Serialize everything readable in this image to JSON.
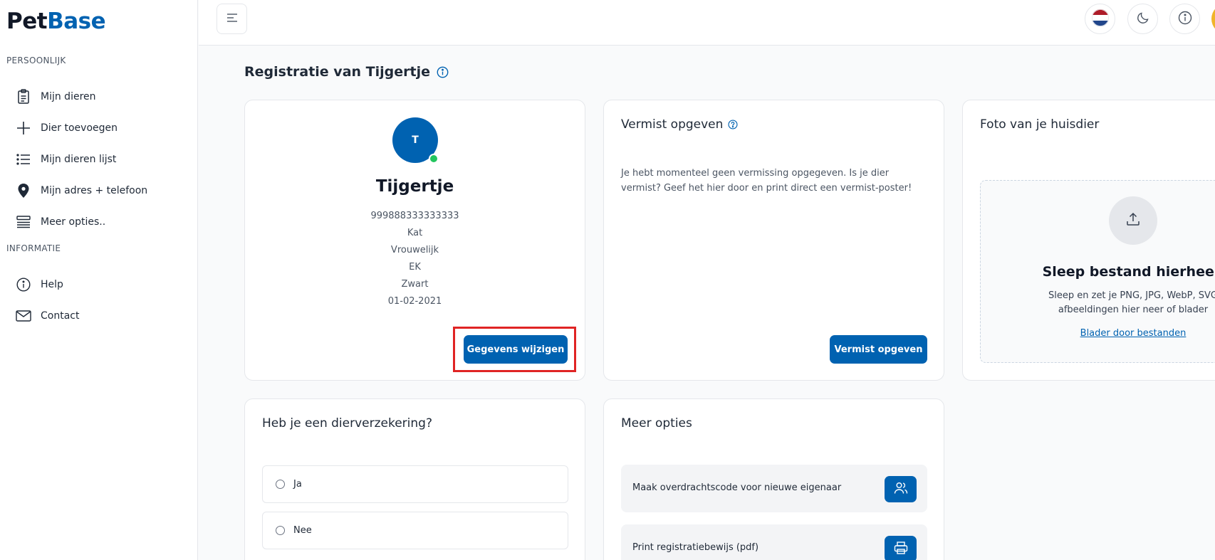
{
  "logo": {
    "part1": "Pet",
    "part2": "Base"
  },
  "sidebar": {
    "personal_label": "PERSOONLIJK",
    "info_label": "INFORMATIE",
    "items": [
      {
        "label": "Mijn dieren",
        "icon": "clipboard-icon"
      },
      {
        "label": "Dier toevoegen",
        "icon": "plus-icon"
      },
      {
        "label": "Mijn dieren lijst",
        "icon": "list-icon"
      },
      {
        "label": "Mijn adres + telefoon",
        "icon": "location-pin-icon"
      },
      {
        "label": "Meer opties..",
        "icon": "stack-icon"
      }
    ],
    "info_items": [
      {
        "label": "Help",
        "icon": "info-icon"
      },
      {
        "label": "Contact",
        "icon": "mail-icon"
      }
    ]
  },
  "header": {
    "title": "Registratie van Tijgertje"
  },
  "pet": {
    "initial": "T",
    "name": "Tijgertje",
    "chip": "999888333333333",
    "species": "Kat",
    "gender": "Vrouwelijk",
    "breed": "EK",
    "color": "Zwart",
    "birthdate": "01-02-2021",
    "edit_label": "Gegevens wijzigen"
  },
  "missing": {
    "title": "Vermist opgeven",
    "text": "Je hebt momenteel geen vermissing opgegeven. Is je dier vermist? Geef het hier door en print direct een vermist-poster!",
    "button": "Vermist opgeven"
  },
  "photo": {
    "title": "Foto van je huisdier",
    "drop_title": "Sleep bestand hierheen",
    "drop_desc1": "Sleep en zet je PNG, JPG, WebP, SVG",
    "drop_desc2": "afbeeldingen hier neer of blader",
    "browse": "Blader door bestanden"
  },
  "insurance": {
    "title": "Heb je een dierverzekering?",
    "options": [
      "Ja",
      "Nee"
    ]
  },
  "more": {
    "title": "Meer opties",
    "options": [
      {
        "label": "Maak overdrachtscode voor nieuwe eigenaar",
        "icon": "users-icon"
      },
      {
        "label": "Print registratiebewijs (pdf)",
        "icon": "printer-icon"
      }
    ]
  },
  "colors": {
    "primary": "#0062b1",
    "online": "#22c55e",
    "highlight": "#e02424"
  }
}
